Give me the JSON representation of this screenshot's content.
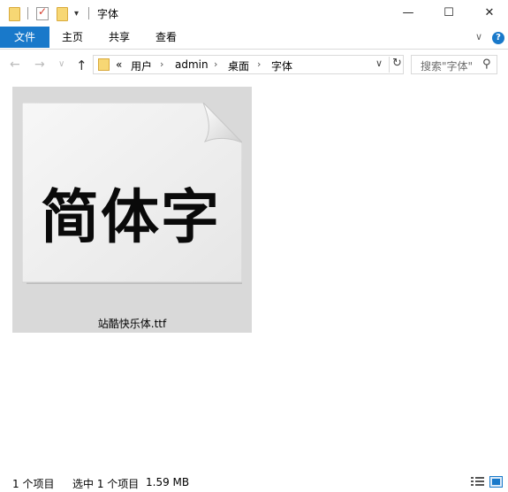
{
  "window": {
    "title": "字体",
    "controls": {
      "minimize": "—",
      "maximize": "☐",
      "close": "✕"
    }
  },
  "quick_access": {
    "icons": [
      "folder-icon",
      "properties-icon",
      "new-folder-icon",
      "customize-dropdown-icon"
    ]
  },
  "ribbon": {
    "tabs": [
      {
        "label": "文件",
        "active": true
      },
      {
        "label": "主页"
      },
      {
        "label": "共享"
      },
      {
        "label": "查看"
      }
    ],
    "expand_glyph": "∨",
    "help_glyph": "?"
  },
  "address": {
    "back_glyph": "←",
    "forward_glyph": "→",
    "recent_glyph": "∨",
    "up_glyph": "↑",
    "overflow": "«",
    "breadcrumbs": [
      "用户",
      "admin",
      "桌面",
      "字体"
    ],
    "separator": "›",
    "dropdown_glyph": "∨",
    "refresh_glyph": "↻"
  },
  "search": {
    "placeholder": "搜索\"字体\"",
    "icon_glyph": "⚲"
  },
  "files": [
    {
      "name": "站酷快乐体.ttf",
      "preview_text": "简体字",
      "selected": true
    }
  ],
  "status": {
    "item_count": "1 个项目",
    "selected": "选中 1 个项目",
    "size": "1.59 MB"
  },
  "colors": {
    "accent": "#1979ca",
    "selection": "#d9d9d9",
    "folder": "#f7d774"
  }
}
